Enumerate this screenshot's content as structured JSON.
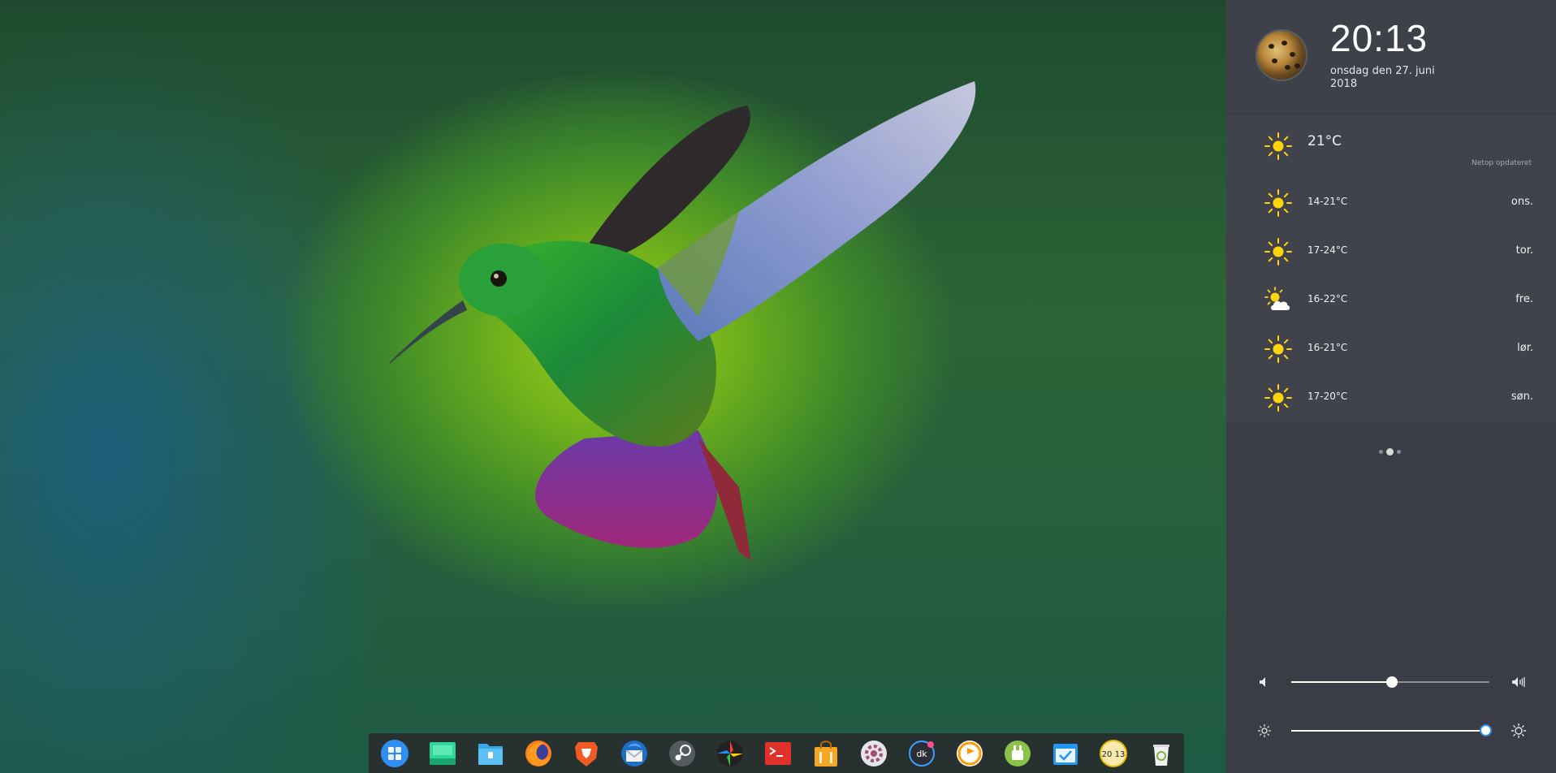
{
  "clock": {
    "time": "20:13",
    "date": "onsdag den 27. juni 2018"
  },
  "weather": {
    "current": {
      "temp": "21°C",
      "status": "Netop opdateret",
      "icon": "sun-icon"
    },
    "forecast": [
      {
        "range": "14-21°C",
        "day": "ons.",
        "icon": "sun-icon"
      },
      {
        "range": "17-24°C",
        "day": "tor.",
        "icon": "sun-icon"
      },
      {
        "range": "16-22°C",
        "day": "fre.",
        "icon": "partly-cloudy-icon"
      },
      {
        "range": "16-21°C",
        "day": "lør.",
        "icon": "sun-icon"
      },
      {
        "range": "17-20°C",
        "day": "søn.",
        "icon": "sun-icon"
      }
    ]
  },
  "pager": {
    "pages": 3,
    "active_index": 1
  },
  "volume": {
    "level": 0.51
  },
  "brightness": {
    "level": 0.98
  },
  "dock": {
    "items": [
      {
        "name": "launcher",
        "icon": "launcher-icon"
      },
      {
        "name": "multitasking",
        "icon": "multitask-icon"
      },
      {
        "name": "file-manager",
        "icon": "folder-icon"
      },
      {
        "name": "firefox",
        "icon": "firefox-icon"
      },
      {
        "name": "brave",
        "icon": "brave-lion-icon"
      },
      {
        "name": "thunderbird",
        "icon": "thunderbird-icon"
      },
      {
        "name": "steam",
        "icon": "steam-icon"
      },
      {
        "name": "image-viewer",
        "icon": "aperture-icon"
      },
      {
        "name": "terminal",
        "icon": "terminal-icon"
      },
      {
        "name": "app-store",
        "icon": "store-bag-icon"
      },
      {
        "name": "control-center",
        "icon": "gear-icon"
      },
      {
        "name": "deepin-kiwi",
        "icon": "dk-icon",
        "label": "dk"
      },
      {
        "name": "music",
        "icon": "music-icon"
      },
      {
        "name": "android-tool",
        "icon": "android-icon"
      },
      {
        "name": "calendar",
        "icon": "calendar-icon"
      },
      {
        "name": "clock",
        "icon": "clock-icon",
        "label": "20 13"
      },
      {
        "name": "trash",
        "icon": "trash-icon"
      }
    ]
  },
  "colors": {
    "panel_bg": "#3a3d45",
    "accent": "#2b8fe8",
    "sun": "#ffd40a"
  }
}
